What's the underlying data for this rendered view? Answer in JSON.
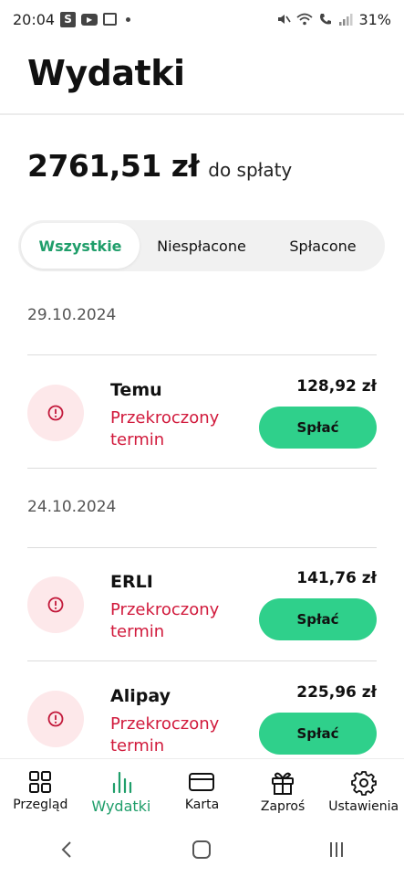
{
  "status_bar": {
    "time": "20:04",
    "battery": "31%",
    "icons": [
      "s-app-icon",
      "youtube-icon",
      "calendar-icon",
      "notification-dot",
      "mute-icon",
      "wifi-icon",
      "wifi-call-icon",
      "signal-icon"
    ]
  },
  "header": {
    "title": "Wydatki"
  },
  "summary": {
    "amount": "2761,51 zł",
    "label": "do spłaty"
  },
  "filters": {
    "tabs": [
      "Wszystkie",
      "Niespłacone",
      "Spłacone"
    ],
    "active": "Wszystkie"
  },
  "groups": [
    {
      "date": "29.10.2024",
      "items": [
        {
          "name": "Temu",
          "status": "Przekroczony termin",
          "amount": "128,92 zł",
          "button": "Spłać"
        }
      ]
    },
    {
      "date": "24.10.2024",
      "items": [
        {
          "name": "ERLI",
          "status": "Przekroczony termin",
          "amount": "141,76 zł",
          "button": "Spłać"
        },
        {
          "name": "Alipay",
          "status": "Przekroczony termin",
          "amount": "225,96 zł",
          "button": "Spłać"
        }
      ]
    }
  ],
  "bottom_nav": [
    {
      "label": "Przegląd",
      "icon": "grid-icon"
    },
    {
      "label": "Wydatki",
      "icon": "bar-chart-icon",
      "active": true
    },
    {
      "label": "Karta",
      "icon": "card-icon"
    },
    {
      "label": "Zaproś",
      "icon": "gift-icon"
    },
    {
      "label": "Ustawienia",
      "icon": "gear-icon"
    }
  ],
  "colors": {
    "accent": "#1f9e6a",
    "button": "#2fd08b",
    "overdue": "#d11a3c",
    "overdue_icon_bg": "#fde8ea"
  }
}
